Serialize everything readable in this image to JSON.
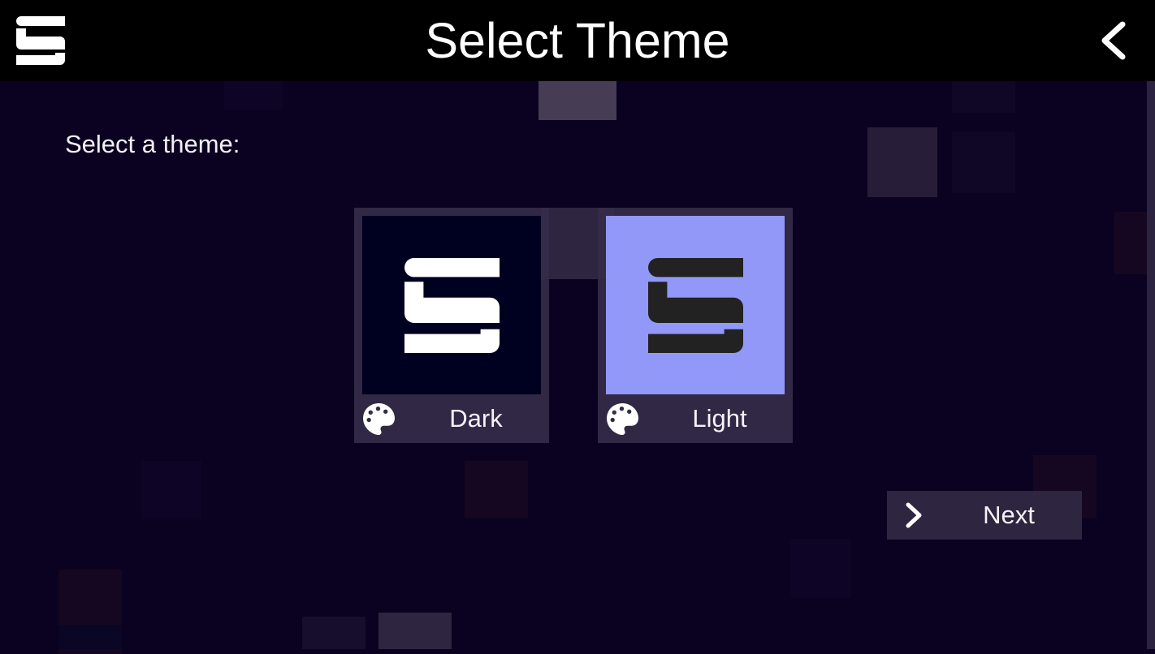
{
  "header": {
    "title": "Select Theme",
    "logo_icon": "app-s-logo-icon",
    "back_icon": "chevron-left-icon"
  },
  "main": {
    "prompt": "Select a theme:",
    "themes": [
      {
        "label": "Dark",
        "icon": "palette-icon",
        "preview_bg": "#000020",
        "logo_color": "#ffffff",
        "selected": false
      },
      {
        "label": "Light",
        "icon": "palette-icon",
        "preview_bg": "#9198f8",
        "logo_color": "#222222",
        "selected": false
      }
    ],
    "next_button": {
      "label": "Next",
      "icon": "chevron-right-icon"
    }
  },
  "colors": {
    "background": "#0a0220",
    "header": "#000000",
    "card": "#342b48",
    "button": "#2e2540"
  }
}
